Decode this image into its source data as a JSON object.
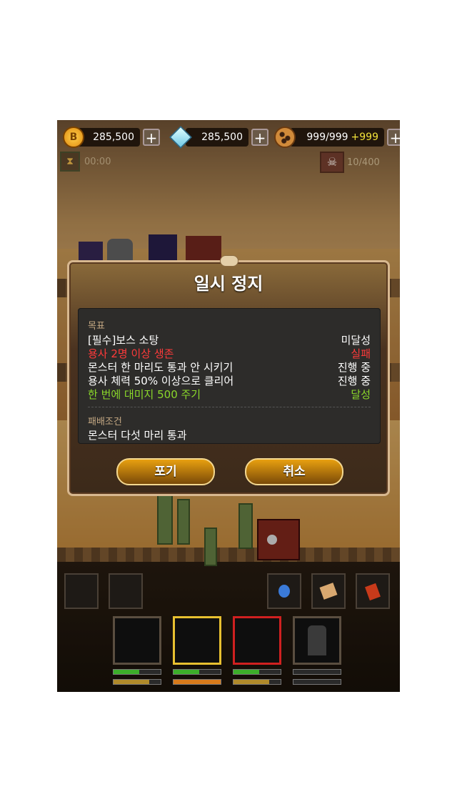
{
  "hud": {
    "gold": {
      "value": "285,500",
      "icon": "gold-coin-icon"
    },
    "gems": {
      "value": "285,500",
      "icon": "diamond-gem-icon"
    },
    "cookies": {
      "value": "999/999",
      "bonus": "+999",
      "icon": "cookie-icon"
    },
    "plus_label": "+"
  },
  "status": {
    "timer": "00:00",
    "kills": "10/400"
  },
  "dialog": {
    "title": "일시 정지",
    "goals_heading": "목표",
    "goals": [
      {
        "text": "[필수]보스 소탕",
        "status": "미달성",
        "color": "#ffffff"
      },
      {
        "text": "용사 2명 이상 생존",
        "status": "실패",
        "color": "#ff3a3a"
      },
      {
        "text": "몬스터 한 마리도 통과 안 시키기",
        "status": "진행 중",
        "color": "#ffffff"
      },
      {
        "text": "용사 체력 50% 이상으로 클리어",
        "status": "진행 중",
        "color": "#ffffff"
      },
      {
        "text": "한 번에 대미지 500 주기",
        "status": "달성",
        "color": "#8ad82a"
      }
    ],
    "defeat_heading": "패배조건",
    "defeat_text": "몬스터 다섯 마리 통과",
    "give_up_label": "포기",
    "cancel_label": "취소"
  },
  "heroes": [
    {
      "hp": 0.55,
      "mp": 0.75,
      "border": "#5a4e40"
    },
    {
      "hp": 0.55,
      "mp": 1.0,
      "border": "#e8c030"
    },
    {
      "hp": 0.55,
      "mp": 0.75,
      "border": "#d02020"
    },
    {
      "hp": 0.0,
      "mp": 0.0,
      "border": "#5a4e40"
    }
  ],
  "colors": {
    "accent": "#f2e23a",
    "fail": "#ff3a3a",
    "success": "#8ad82a"
  }
}
